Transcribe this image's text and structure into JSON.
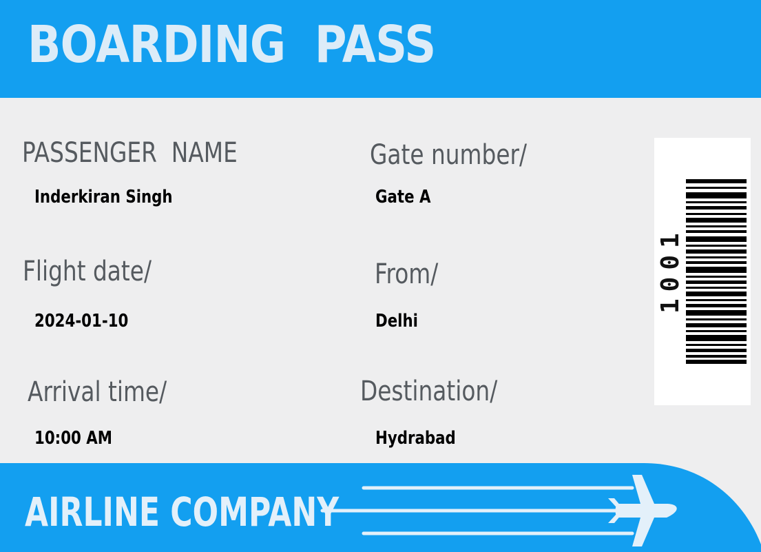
{
  "header": {
    "title": "BOARDING  PASS"
  },
  "fields": {
    "passenger_name": {
      "label": "PASSENGER  NAME",
      "value": "Inderkiran Singh"
    },
    "gate_number": {
      "label": "Gate number/",
      "value": "Gate A"
    },
    "flight_date": {
      "label": "Flight date/",
      "value": "2024-01-10"
    },
    "from": {
      "label": "From/",
      "value": "Delhi"
    },
    "arrival_time": {
      "label": "Arrival time/",
      "value": "10:00 AM"
    },
    "destination": {
      "label": "Destination/",
      "value": "Hydrabad"
    }
  },
  "barcode": {
    "number": "1001"
  },
  "footer": {
    "company": "AIRLINE COMPANY",
    "icon": "airplane-icon"
  },
  "colors": {
    "brand_blue": "#139ff0",
    "card_background": "#eeeeef",
    "header_text": "#dcecf8",
    "label_text": "#555a5f",
    "value_text": "#000000"
  }
}
